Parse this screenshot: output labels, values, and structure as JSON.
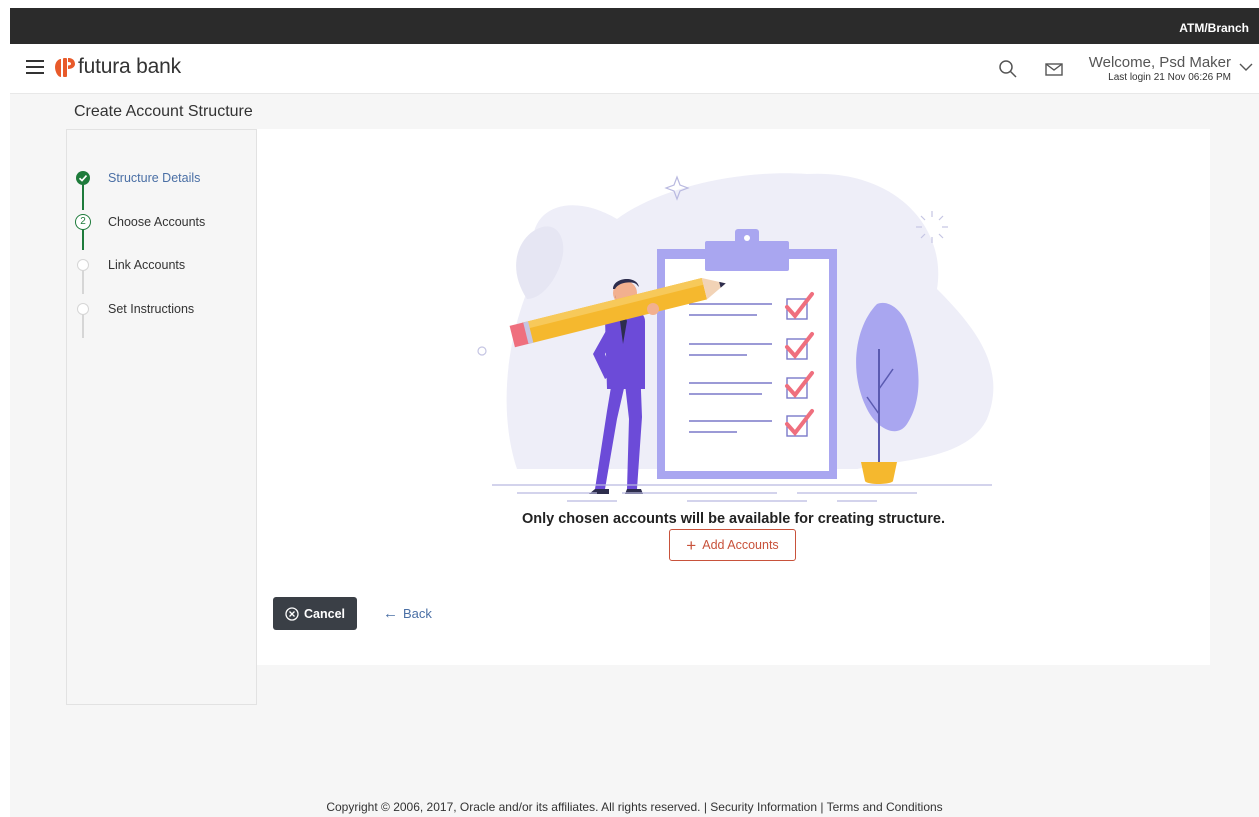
{
  "topbar": {
    "label": "ATM/Branch"
  },
  "brand": {
    "name": "futura bank",
    "accent": "#e85a2a"
  },
  "header": {
    "icons": [
      "hamburger-menu-icon",
      "search-icon",
      "mail-icon",
      "chevron-down-icon"
    ],
    "welcome": "Welcome, Psd Maker",
    "last_login": "Last login 21 Nov 06:26 PM"
  },
  "page": {
    "title": "Create Account Structure"
  },
  "stepper": {
    "steps": [
      {
        "label": "Structure Details",
        "state": "completed"
      },
      {
        "label": "Choose Accounts",
        "state": "current",
        "number": "2"
      },
      {
        "label": "Link Accounts",
        "state": "pending"
      },
      {
        "label": "Set Instructions",
        "state": "pending"
      }
    ]
  },
  "main": {
    "message": "Only chosen accounts will be available for creating structure.",
    "add_button": "Add Accounts",
    "cancel_button": "Cancel",
    "back_link": "Back"
  },
  "footer": {
    "copyright": "Copyright © 2006, 2017, Oracle and/or its affiliates. All rights reserved.",
    "separator": "|",
    "security": "Security Information",
    "terms": "Terms and Conditions"
  },
  "colors": {
    "topbar": "#2b2b2b",
    "step_complete": "#1e7b3b",
    "primary_dark": "#3a3f46",
    "link": "#4a6fa5",
    "accent_red": "#c8523b"
  }
}
